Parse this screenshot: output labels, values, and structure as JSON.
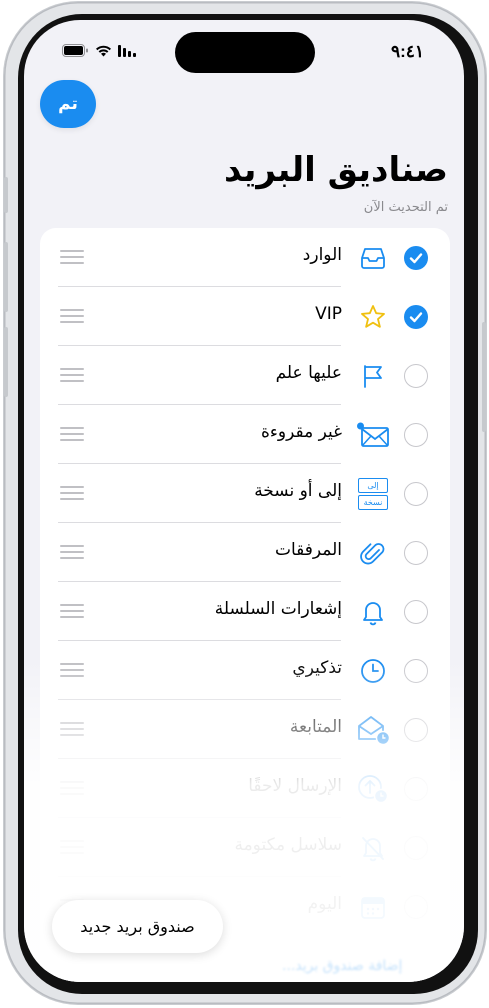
{
  "status": {
    "time": "٩:٤١"
  },
  "header": {
    "done_label": "تم",
    "title": "صناديق البريد",
    "subtitle": "تم التحديث الآن"
  },
  "mailboxes": [
    {
      "label": "الوارد",
      "checked": true,
      "icon": "inbox-icon"
    },
    {
      "label": "VIP",
      "checked": true,
      "icon": "star-icon"
    },
    {
      "label": "عليها علم",
      "checked": false,
      "icon": "flag-icon"
    },
    {
      "label": "غير مقروءة",
      "checked": false,
      "icon": "unread-envelope-icon"
    },
    {
      "label": "إلى أو نسخة",
      "checked": false,
      "icon": "to-cc-icon"
    },
    {
      "label": "المرفقات",
      "checked": false,
      "icon": "paperclip-icon"
    },
    {
      "label": "إشعارات السلسلة",
      "checked": false,
      "icon": "bell-icon"
    },
    {
      "label": "تذكيري",
      "checked": false,
      "icon": "clock-icon"
    },
    {
      "label": "المتابعة",
      "checked": false,
      "icon": "follow-up-envelope-icon"
    },
    {
      "label": "الإرسال لاحقًا",
      "checked": false,
      "icon": "send-later-icon"
    },
    {
      "label": "سلاسل مكتومة",
      "checked": false,
      "icon": "muted-bell-icon"
    },
    {
      "label": "اليوم",
      "checked": false,
      "icon": "calendar-icon"
    }
  ],
  "to_cc_icon_text": {
    "to": "إلى",
    "cc": "نسخة"
  },
  "footer": {
    "new_mailbox_label": "صندوق بريد جديد",
    "add_mailbox_link": "إضافة صندوق بريد..."
  },
  "colors": {
    "accent": "#1a8cf0",
    "star": "#f5c518",
    "background": "#f2f2f7"
  }
}
